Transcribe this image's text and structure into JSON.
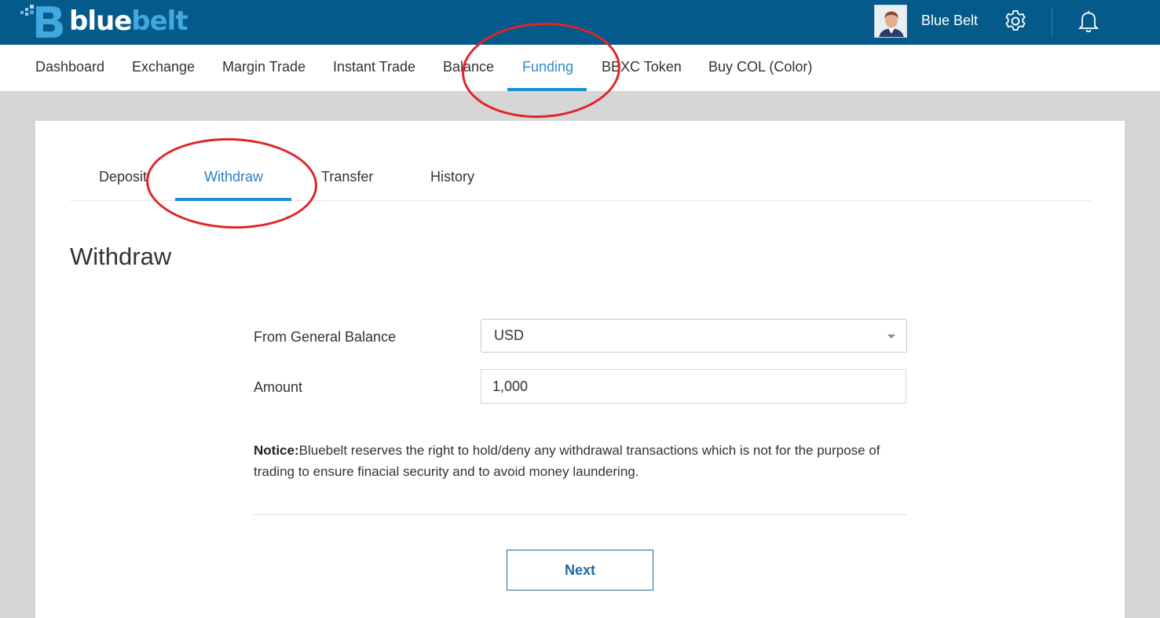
{
  "brand": {
    "logo_part1": "blue",
    "logo_part2": "belt",
    "logo_icon": "bluebelt-b-logo-icon"
  },
  "user": {
    "name": "Blue Belt",
    "avatar_icon": "avatar-icon",
    "settings_icon": "gear-icon",
    "notifications_icon": "bell-icon"
  },
  "main_nav": {
    "items": [
      {
        "label": "Dashboard"
      },
      {
        "label": "Exchange"
      },
      {
        "label": "Margin Trade"
      },
      {
        "label": "Instant Trade"
      },
      {
        "label": "Balance"
      },
      {
        "label": "Funding",
        "active": true
      },
      {
        "label": "BBXC Token"
      },
      {
        "label": "Buy COL (Color)"
      }
    ]
  },
  "sub_tabs": {
    "items": [
      {
        "label": "Deposit"
      },
      {
        "label": "Withdraw",
        "active": true
      },
      {
        "label": "Transfer"
      },
      {
        "label": "History"
      }
    ]
  },
  "withdraw_form": {
    "title": "Withdraw",
    "from_label": "From General Balance",
    "currency_value": "USD",
    "amount_label": "Amount",
    "amount_value": "1,000",
    "notice_label": "Notice:",
    "notice_text": "Bluebelt reserves the right to hold/deny any withdrawal transactions which is not for the purpose of trading to ensure finacial security and to avoid money laundering.",
    "next_label": "Next"
  },
  "colors": {
    "topbar": "#045a8a",
    "accent": "#1e8fd3",
    "annotation_red": "#e0242a"
  }
}
